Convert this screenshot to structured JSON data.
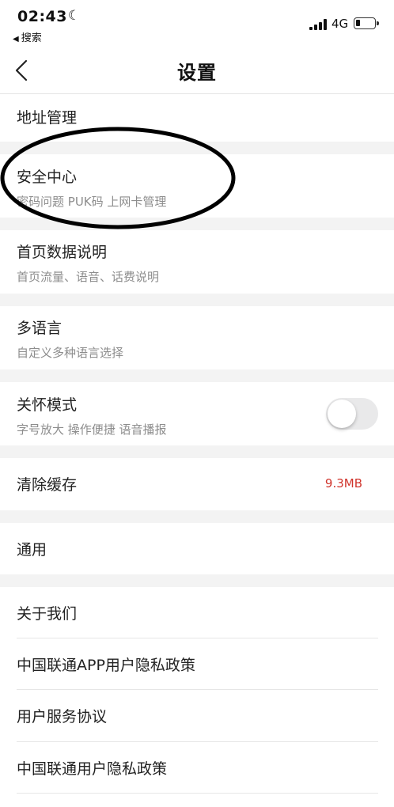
{
  "status_bar": {
    "time": "02:43",
    "back_app": "搜索",
    "network": "4G",
    "battery_level": 0.25
  },
  "nav": {
    "title": "设置"
  },
  "settings": {
    "address": {
      "label": "地址管理"
    },
    "security": {
      "label": "安全中心",
      "sub": "密码问题 PUK码 上网卡管理"
    },
    "home_data": {
      "label": "首页数据说明",
      "sub": "首页流量、语音、话费说明"
    },
    "language": {
      "label": "多语言",
      "sub": "自定义多种语言选择"
    },
    "care_mode": {
      "label": "关怀模式",
      "sub": "字号放大 操作便捷 语音播报",
      "enabled": false
    },
    "cache": {
      "label": "清除缓存",
      "value": "9.3MB"
    },
    "general": {
      "label": "通用"
    },
    "about": {
      "label": "关于我们"
    },
    "app_privacy": {
      "label": "中国联通APP用户隐私政策"
    },
    "service_agreement": {
      "label": "用户服务协议"
    },
    "user_privacy": {
      "label": "中国联通用户隐私政策"
    }
  },
  "colors": {
    "accent_red": "#d0342c",
    "divider_gray": "#f3f3f3",
    "annotation": "#000000"
  }
}
